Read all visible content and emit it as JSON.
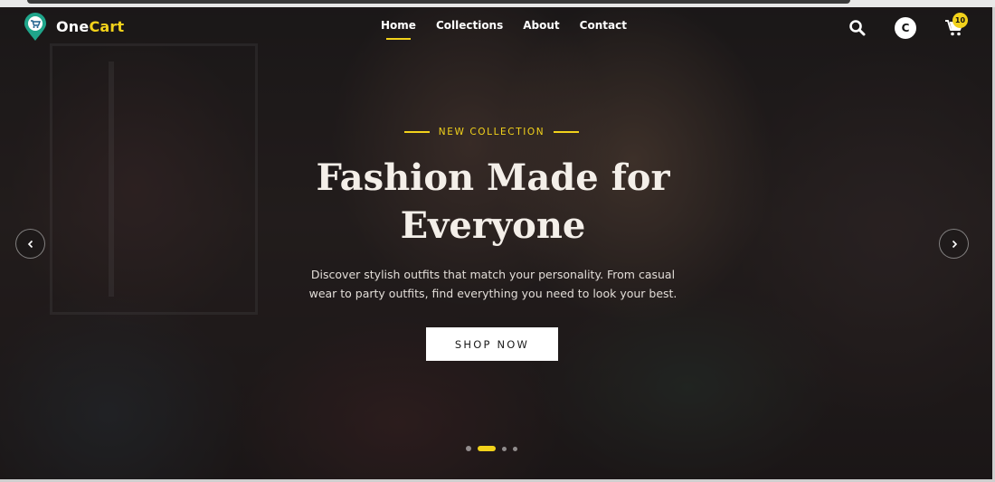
{
  "brand": {
    "name_part1": "One",
    "name_part2": "Cart",
    "logo_icon": "cart-pin-icon"
  },
  "nav": {
    "items": [
      {
        "label": "Home",
        "active": true
      },
      {
        "label": "Collections",
        "active": false
      },
      {
        "label": "About",
        "active": false
      },
      {
        "label": "Contact",
        "active": false
      }
    ]
  },
  "header": {
    "avatar_initial": "C",
    "cart_count": "10"
  },
  "hero": {
    "kicker": "NEW COLLECTION",
    "title_line1": "Fashion Made for",
    "title_line2": "Everyone",
    "subtitle": "Discover stylish outfits that match your personality. From casual wear to party outfits, find everything you need to look your best.",
    "cta_label": "SHOP NOW",
    "slides_total": 4,
    "active_slide": 2
  },
  "colors": {
    "accent": "#f2d21b",
    "text_light": "#f4efe9",
    "overlay": "#0f0c0e"
  }
}
